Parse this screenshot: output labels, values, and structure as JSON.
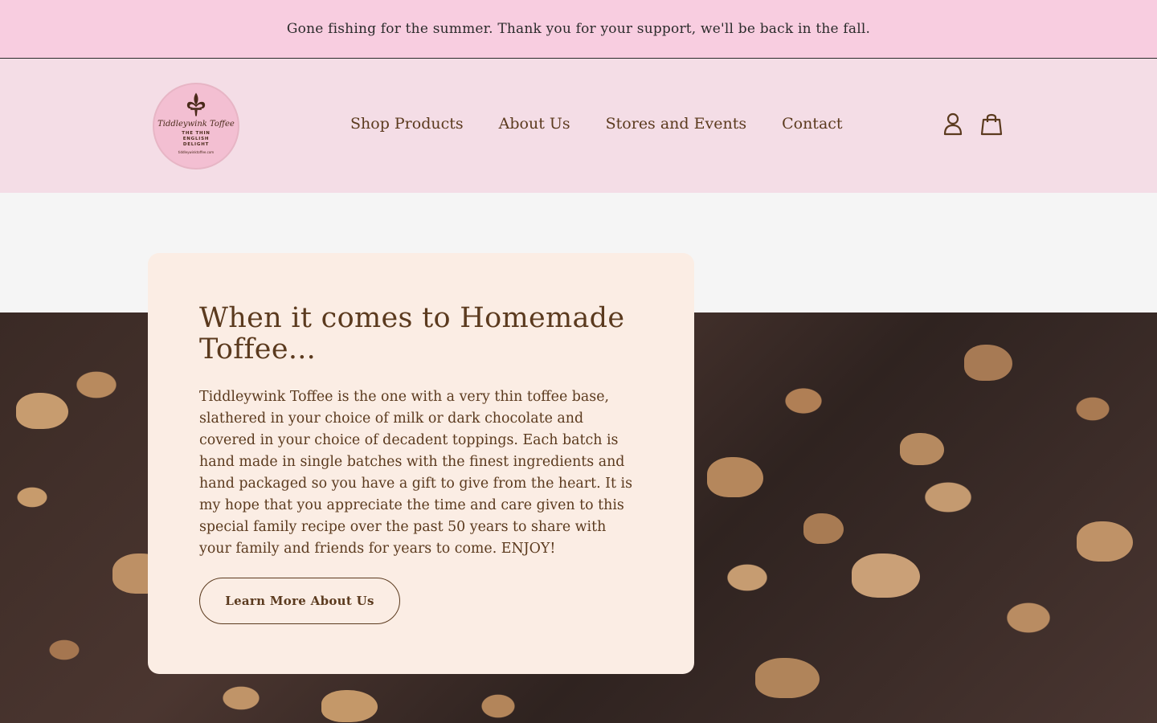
{
  "announcement": {
    "text": "Gone fishing for the summer. Thank you for your support, we'll be back in the fall."
  },
  "logo": {
    "brand": "Tiddleywink Toffee",
    "tagline": "THE THIN ENGLISH DELIGHT",
    "url": "tiddleywinktoffee.com"
  },
  "nav": {
    "items": [
      {
        "label": "Shop Products"
      },
      {
        "label": "About Us"
      },
      {
        "label": "Stores and Events"
      },
      {
        "label": "Contact"
      }
    ]
  },
  "header_icons": {
    "account": "account-icon",
    "cart": "cart-icon"
  },
  "hero": {
    "title": "When it comes to Homemade Toffee...",
    "body": "Tiddleywink Toffee is the one with a very thin toffee base, slathered in your choice of milk or dark chocolate and covered in your choice of decadent toppings. Each batch is hand made in single batches with the finest ingredients and hand packaged so you have a gift to give from the heart. It is my hope that you appreciate the time and care given to this special family recipe over the past 50 years to share with your family and friends for years to come. ENJOY!",
    "button_label": "Learn More About Us"
  },
  "colors": {
    "announcement_bg": "#f8cde0",
    "header_bg": "#f4dde6",
    "card_bg": "#fbede4",
    "text": "#5b3a1e"
  }
}
